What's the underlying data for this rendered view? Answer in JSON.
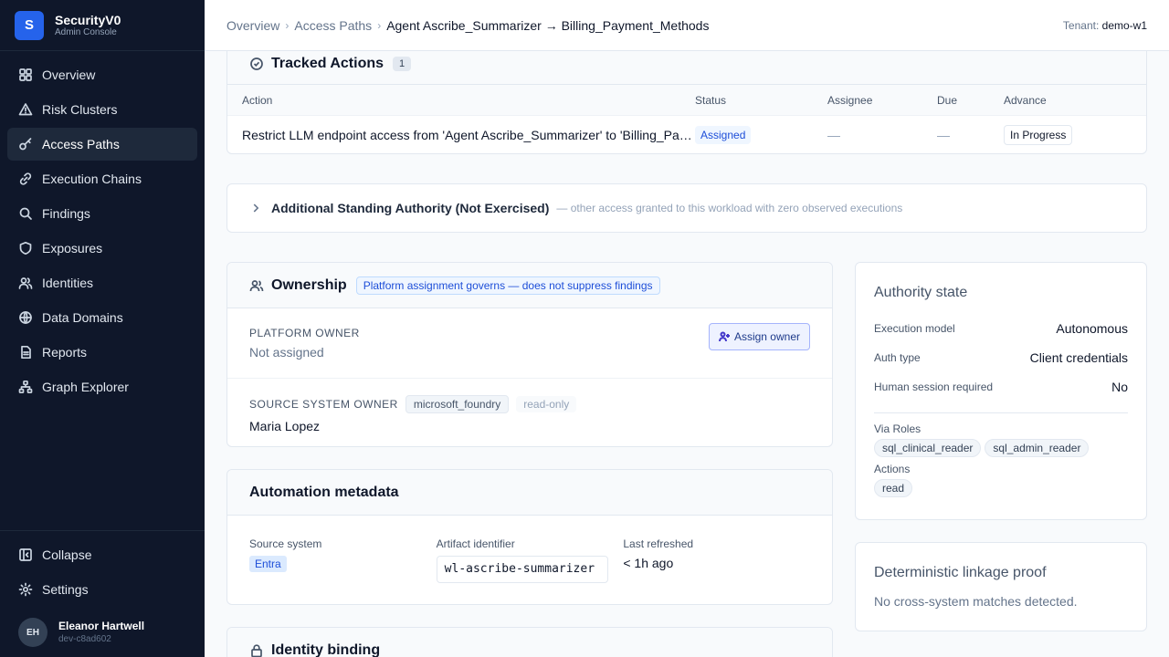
{
  "brand": {
    "logo_letter": "S",
    "name": "SecurityV0",
    "subtitle": "Admin Console"
  },
  "sidebar": {
    "items": [
      {
        "label": "Overview",
        "icon": "grid-icon"
      },
      {
        "label": "Risk Clusters",
        "icon": "warning-icon"
      },
      {
        "label": "Access Paths",
        "icon": "key-icon",
        "active": true
      },
      {
        "label": "Execution Chains",
        "icon": "link-icon"
      },
      {
        "label": "Findings",
        "icon": "search-icon"
      },
      {
        "label": "Exposures",
        "icon": "shield-icon"
      },
      {
        "label": "Identities",
        "icon": "users-icon"
      },
      {
        "label": "Data Domains",
        "icon": "globe-icon"
      },
      {
        "label": "Reports",
        "icon": "document-icon"
      },
      {
        "label": "Graph Explorer",
        "icon": "graph-icon"
      }
    ],
    "collapse_label": "Collapse",
    "settings_label": "Settings",
    "user": {
      "initials": "EH",
      "name": "Eleanor Hartwell",
      "id": "dev-c8ad602"
    }
  },
  "header": {
    "breadcrumbs": [
      "Overview",
      "Access Paths",
      "Agent Ascribe_Summarizer → Billing_Payment_Methods"
    ],
    "tenant_label": "Tenant:",
    "tenant_value": "demo-w1"
  },
  "tracked_actions": {
    "title": "Tracked Actions",
    "count": "1",
    "columns": [
      "Action",
      "Status",
      "Assignee",
      "Due",
      "Advance"
    ],
    "rows": [
      {
        "action": "Restrict LLM endpoint access from 'Agent Ascribe_Summarizer' to 'Billing_Payment_Methods'",
        "status": "Assigned",
        "assignee": "—",
        "due": "—",
        "advance": "In Progress"
      }
    ]
  },
  "standing_authority": {
    "title": "Additional Standing Authority (Not Exercised)",
    "description": "— other access granted to this workload with zero observed executions"
  },
  "ownership": {
    "title": "Ownership",
    "badge": "Platform assignment governs — does not suppress findings",
    "platform_owner_label": "PLATFORM OWNER",
    "platform_owner_value": "Not assigned",
    "assign_button": "Assign owner",
    "source_owner_label": "SOURCE SYSTEM OWNER",
    "source_chip": "microsoft_foundry",
    "readonly_chip": "read-only",
    "source_owner_value": "Maria Lopez"
  },
  "automation": {
    "title": "Automation metadata",
    "source_label": "Source system",
    "source_value": "Entra",
    "artifact_label": "Artifact identifier",
    "artifact_value": "wl-ascribe-summarizer",
    "refreshed_label": "Last refreshed",
    "refreshed_value": "< 1h ago"
  },
  "identity_binding": {
    "title": "Identity binding"
  },
  "authority_state": {
    "title": "Authority state",
    "rows": [
      {
        "key": "Execution model",
        "value": "Autonomous"
      },
      {
        "key": "Auth type",
        "value": "Client credentials"
      },
      {
        "key": "Human session required",
        "value": "No"
      }
    ],
    "roles_label": "Via Roles",
    "roles": [
      "sql_clinical_reader",
      "sql_admin_reader"
    ],
    "actions_label": "Actions",
    "actions": [
      "read"
    ]
  },
  "linkage": {
    "title": "Deterministic linkage proof",
    "text": "No cross-system matches detected."
  }
}
